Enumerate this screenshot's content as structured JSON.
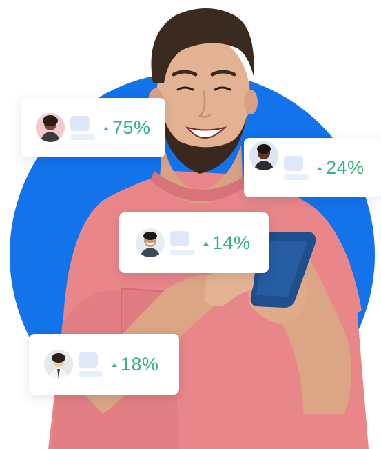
{
  "colors": {
    "circle": "#1273eb",
    "stat_green": "#35b37e",
    "card_bg": "#ffffff",
    "placeholder": "#dfe8fb",
    "shirt": "#e8868a"
  },
  "icons": {
    "trend": "up-triangle-icon"
  },
  "cards": [
    {
      "value": "75%"
    },
    {
      "value": "24%"
    },
    {
      "value": "14%"
    },
    {
      "value": "18%"
    }
  ]
}
